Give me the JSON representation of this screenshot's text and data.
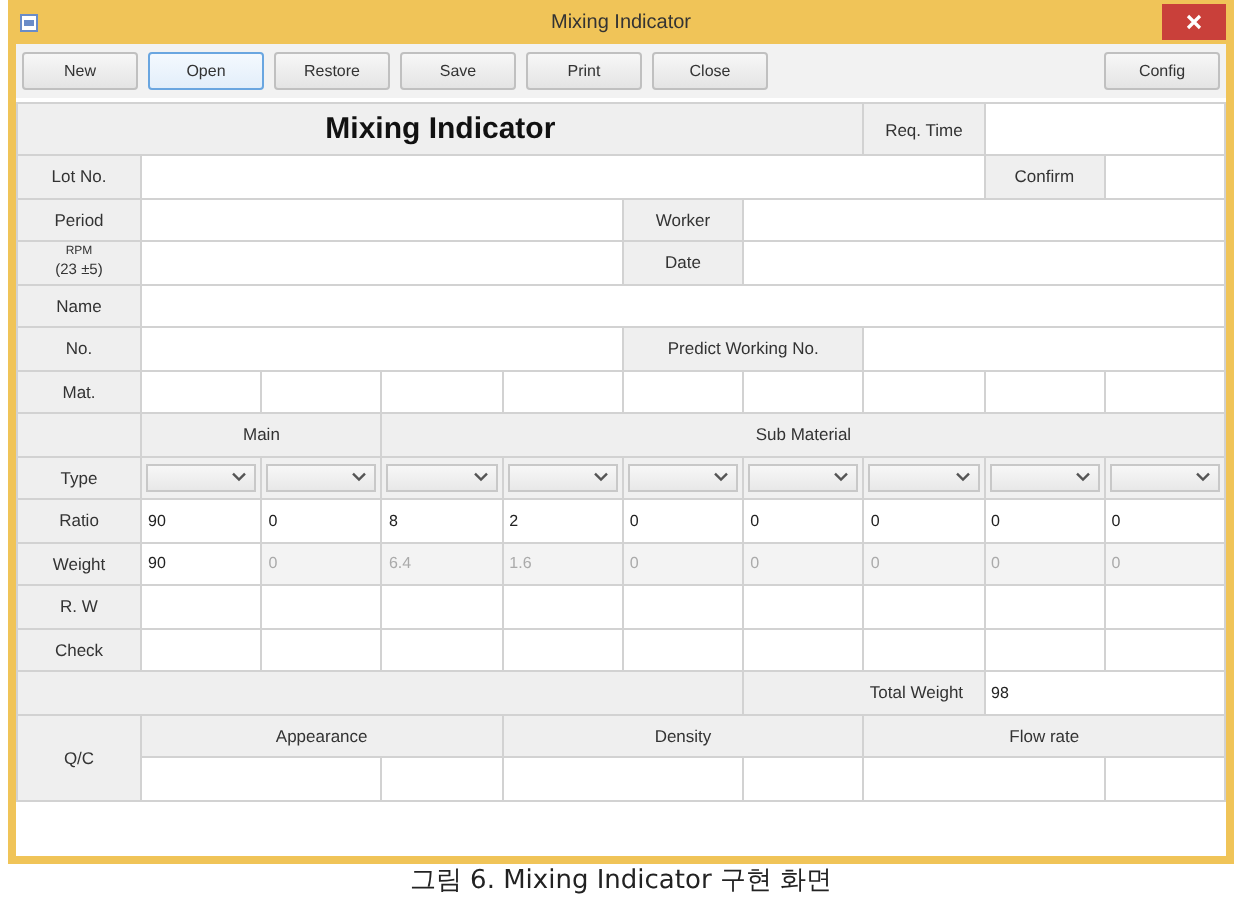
{
  "window": {
    "title": "Mixing Indicator"
  },
  "toolbar": [
    {
      "label": "New",
      "selected": false
    },
    {
      "label": "Open",
      "selected": true
    },
    {
      "label": "Restore",
      "selected": false
    },
    {
      "label": "Save",
      "selected": false
    },
    {
      "label": "Print",
      "selected": false
    },
    {
      "label": "Close",
      "selected": false
    }
  ],
  "toolbar_right": [
    {
      "label": "Config",
      "selected": false
    }
  ],
  "form": {
    "heading": "Mixing Indicator",
    "req_time_label": "Req. Time",
    "lot_label": "Lot No.",
    "confirm_label": "Confirm",
    "period_label": "Period",
    "worker_label": "Worker",
    "rpm_label": "RPM",
    "rpm_range": "(23 ±5)",
    "date_label": "Date",
    "name_label": "Name",
    "no_label": "No.",
    "predict_label": "Predict Working No.",
    "mat_label": "Mat.",
    "main_label": "Main",
    "sub_label": "Sub Material",
    "type_label": "Type",
    "type_dropdowns": [
      {
        "kind": "dropdown"
      },
      {
        "kind": "dropdown"
      },
      {
        "kind": "dropdown"
      },
      {
        "kind": "dropdown"
      },
      {
        "kind": "dropdown"
      },
      {
        "kind": "dropdown"
      },
      {
        "kind": "dropdown"
      },
      {
        "kind": "dropdown"
      },
      {
        "kind": "dropdown"
      }
    ],
    "ratio_label": "Ratio",
    "ratios": [
      "90",
      "0",
      "8",
      "2",
      "0",
      "0",
      "0",
      "0",
      "0"
    ],
    "weight_label": "Weight",
    "weights": [
      {
        "value": "90",
        "disabled": false
      },
      {
        "value": "0",
        "disabled": true
      },
      {
        "value": "6.4",
        "disabled": true
      },
      {
        "value": "1.6",
        "disabled": true
      },
      {
        "value": "0",
        "disabled": true
      },
      {
        "value": "0",
        "disabled": true
      },
      {
        "value": "0",
        "disabled": true
      },
      {
        "value": "0",
        "disabled": true
      },
      {
        "value": "0",
        "disabled": true
      }
    ],
    "rw_label": "R. W",
    "check_label": "Check",
    "total_label": "Total Weight",
    "total_value": "98",
    "qc_label": "Q/C",
    "qc_columns": [
      "Appearance",
      "Density",
      "Flow rate"
    ]
  },
  "caption": "그림 6. Mixing Indicator 구현 화면"
}
